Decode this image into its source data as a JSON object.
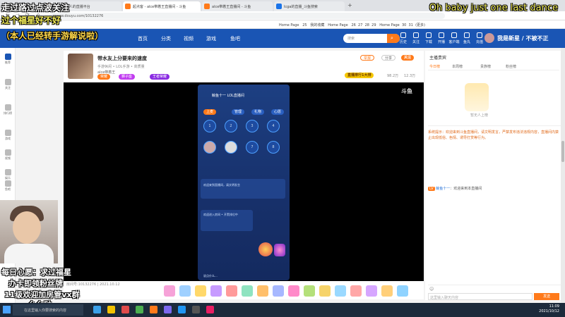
{
  "browser": {
    "tabs": [
      {
        "label": "斗鱼-每个人的直播平台",
        "active": false
      },
      {
        "label": "起点客 - alce带着王直播间 - 斗鱼",
        "active": true
      },
      {
        "label": "alce带着王直播间 - 斗鱼",
        "active": false
      },
      {
        "label": "lcga的直播_斗鱼搜索",
        "active": false
      }
    ],
    "url": "www.douyu.com/10132276",
    "bookmarks": [
      "Home Page",
      "25",
      "我的收藏",
      "Home Page",
      "26",
      "27",
      "28",
      "29",
      "Home Page",
      "30",
      "31",
      "(更多)"
    ]
  },
  "douyu_header": {
    "nav": [
      "首页",
      "分类",
      "视频",
      "游戏",
      "鱼吧"
    ],
    "search_placeholder": "搜索",
    "icons": [
      "历史",
      "关注",
      "下载",
      "开播",
      "客户端",
      "鱼丸",
      "充值",
      "消息"
    ],
    "user_tag": "我是新星 / 不被不正"
  },
  "sidebar": [
    "推荐",
    "关注",
    "排行榜",
    "游戏",
    "视频",
    "娱乐",
    "鱼吧",
    "云游戏",
    "更多"
  ],
  "room": {
    "title": "带水友上分要来的速度",
    "subtitle": "手游休闲 • LOL手游 • 高质量",
    "host": "alce带着王",
    "buttons": [
      "举报",
      "分享",
      "关注"
    ],
    "tags": [
      "荣耀",
      "狮子座",
      "王者荣耀"
    ],
    "follower_badge": "直播排行1大排",
    "stats": [
      "98.2万",
      "12.3万"
    ]
  },
  "video": {
    "watermark": "斗鱼",
    "room_id": "douyu.com",
    "phone_title": "鲸鱼十一 LOL直播间",
    "phone_buttons": [
      "上麦",
      "管理",
      "礼物",
      "心愿"
    ],
    "phone_chat_1": "欢迎来到直播间，请文明发言",
    "phone_chat_2": "欢迎进入房间 • 开黑排位中",
    "phone_bottom": "说点什么..."
  },
  "right_panel": {
    "tabs": [
      "今日榜",
      "本周榜",
      "贵族榜",
      "粉丝榜"
    ],
    "top_label": "主播贵宾",
    "avatar_caption": "暂无人上榜",
    "system_notice": "系统提示：欢迎来到斗鱼直播间，请文明发言，严禁发布违法违规内容，直播间内禁止出现低俗、色情、诱导打赏等行为。",
    "chat_msg": "欢迎来到本直播间",
    "chat_user": "鲸鱼十一",
    "input_placeholder": "这里输入聊天内容",
    "send": "发送"
  },
  "bottombar": {
    "room_line": "房间号:10132276 | 2021.10.12"
  },
  "overlays": {
    "top_left_line1": "走过路过点波关注",
    "top_left_line2": "过个福星好不好",
    "top_left_line3": "（本人已经转手游解说啦）",
    "top_right": "Oh baby just one last dance",
    "bottom_line1": "每日心愿：求过福星",
    "bottom_line2": "办卡即领粉丝牌",
    "bottom_line3": "11级欢迎加房管vx群",
    "bottom_line4": "么么哒"
  },
  "taskbar": {
    "search": "在这里输入你要搜索的内容",
    "time": "11:09",
    "date": "2021/10/12"
  },
  "colors": {
    "douyu_blue": "#1a55b4",
    "douyu_orange": "#ff7a1a",
    "overlay_yellow": "#f5ef5a"
  }
}
